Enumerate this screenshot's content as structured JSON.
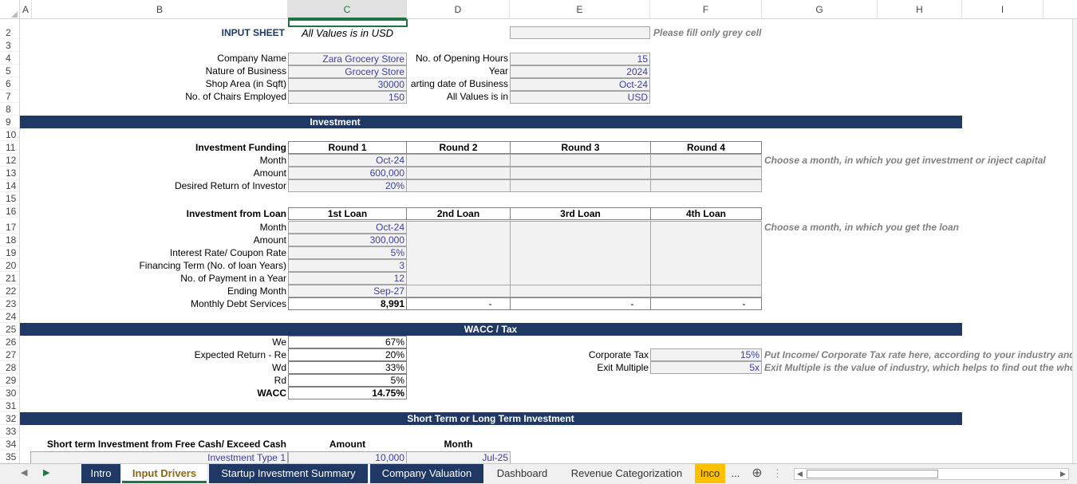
{
  "columns": [
    "A",
    "B",
    "C",
    "D",
    "E",
    "F",
    "G",
    "H",
    "I"
  ],
  "rows": [
    "2",
    "3",
    "4",
    "5",
    "6",
    "7",
    "8",
    "9",
    "10",
    "11",
    "12",
    "13",
    "14",
    "15",
    "16",
    "17",
    "18",
    "19",
    "20",
    "21",
    "22",
    "23",
    "24",
    "25",
    "26",
    "27",
    "28",
    "29",
    "30",
    "31",
    "32",
    "33",
    "34",
    "35"
  ],
  "header": {
    "title": "INPUT SHEET",
    "currency_note": "All Values is in USD",
    "fill_hint": "Please fill only grey cell"
  },
  "company": {
    "labels": [
      "Company Name",
      "Nature of Business",
      "Shop Area (in Sqft)",
      "No. of Chairs Employed"
    ],
    "values": [
      "Zara Grocery Store",
      "Grocery Store",
      "30000",
      "150"
    ],
    "labels2": [
      "No. of Opening Hours",
      "Year",
      "arting date of Business",
      "All Values is in"
    ],
    "values2": [
      "15",
      "2024",
      "Oct-24",
      "USD"
    ]
  },
  "investment": {
    "band": "Investment",
    "heading": "Investment Funding",
    "rounds": [
      "Round 1",
      "Round 2",
      "Round 3",
      "Round 4"
    ],
    "row_labels": [
      "Month",
      "Amount",
      "Desired Return of Investor"
    ],
    "round1": [
      "Oct-24",
      "600,000",
      "20%"
    ],
    "hint": "Choose a month, in which you get investment or inject capital"
  },
  "loan": {
    "heading": "Investment from Loan",
    "loans": [
      "1st Loan",
      "2nd Loan",
      "3rd Loan",
      "4th Loan"
    ],
    "row_labels": [
      "Month",
      "Amount",
      "Interest Rate/ Coupon Rate",
      "Financing Term (No. of loan Years)",
      "No. of Payment in a Year",
      "Ending Month",
      "Monthly Debt Services"
    ],
    "loan1": [
      "Oct-24",
      "300,000",
      "5%",
      "3",
      "12",
      "Sep-27",
      "8,991"
    ],
    "debt_other": [
      "-",
      "-",
      "-"
    ],
    "hint": "Choose a month, in which you get the loan"
  },
  "wacc": {
    "band": "WACC / Tax",
    "labels": [
      "We",
      "Expected Return - Re",
      "Wd",
      "Rd",
      "WACC"
    ],
    "values": [
      "67%",
      "20%",
      "33%",
      "5%",
      "14.75%"
    ],
    "corp_tax_label": "Corporate Tax",
    "corp_tax_value": "15%",
    "corp_tax_hint": "Put Income/ Corporate Tax rate here, according to your industry and",
    "exit_label": "Exit Multiple",
    "exit_value": "5x",
    "exit_hint": "Exit Multiple is the value of industry, which helps to find out the whol"
  },
  "short_term": {
    "band": "Short Term or Long Term Investment",
    "heading": "Short term Investment from Free Cash/ Exceed Cash",
    "amount_header": "Amount",
    "month_header": "Month",
    "type1_label": "Investment Type 1",
    "type1_amount": "10,000",
    "type1_month": "Jul-25"
  },
  "tabs": [
    "Intro",
    "Input Drivers",
    "Startup Investment Summary",
    "Company Valuation",
    "Dashboard",
    "Revenue Categorization",
    "Inco"
  ],
  "tab_overflow": "...",
  "colors": {
    "band": "#1f3864",
    "grid_accent": "#217346",
    "input_blue": "#3b3fa0",
    "orange_tab": "#ffc000"
  }
}
